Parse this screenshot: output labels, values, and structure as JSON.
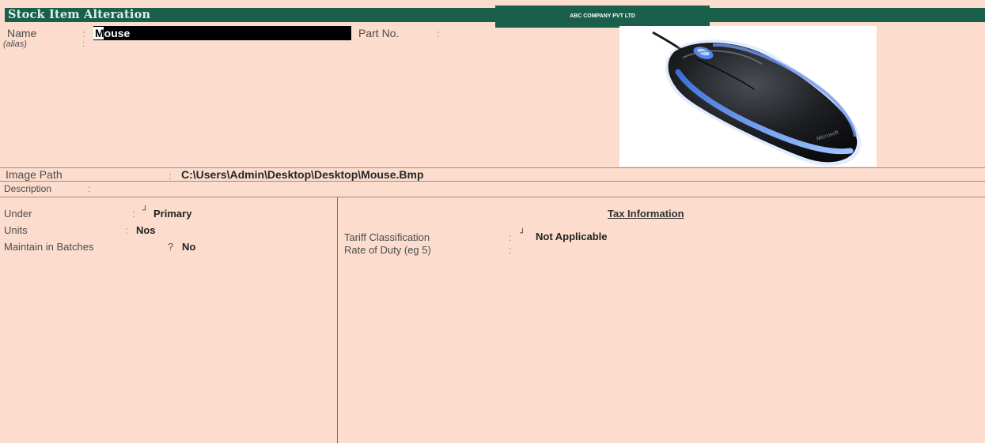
{
  "window": {
    "title": "Stock Item Alteration",
    "company": "ABC COMPANY PVT LTD"
  },
  "item": {
    "name_label": "Name",
    "name_value_first": "M",
    "name_value_rest": "ouse",
    "alias_label": "(alias)",
    "part_no_label": "Part No.",
    "image_path_label": "Image Path",
    "image_path_value": "C:\\Users\\Admin\\Desktop\\Desktop\\Mouse.Bmp",
    "description_label": "Description"
  },
  "left_panel": {
    "under_label": "Under",
    "under_value": "Primary",
    "units_label": "Units",
    "units_value": "Nos",
    "batches_label": "Maintain in Batches",
    "batches_value": "No"
  },
  "tax": {
    "header": "Tax Information",
    "tariff_label": "Tariff Classification",
    "tariff_value": "Not Applicable",
    "rate_label": "Rate of Duty (eg 5)"
  },
  "colors": {
    "background": "#fbdccd",
    "title_bar": "#1a5e4c"
  },
  "icons": {
    "item_image": "computer-mouse"
  }
}
